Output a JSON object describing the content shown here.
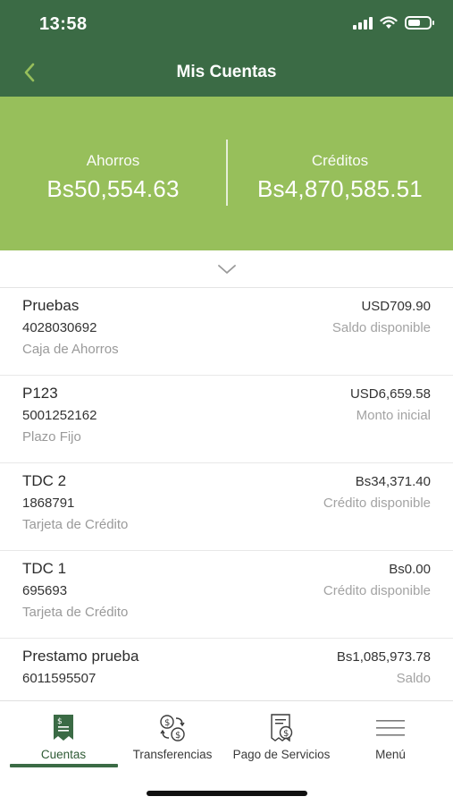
{
  "status": {
    "time": "13:58"
  },
  "nav": {
    "title": "Mis Cuentas"
  },
  "summary": {
    "savings": {
      "label": "Ahorros",
      "amount": "Bs50,554.63"
    },
    "credits": {
      "label": "Créditos",
      "amount": "Bs4,870,585.51"
    }
  },
  "accounts": [
    {
      "name": "Pruebas",
      "number": "4028030692",
      "type": "Caja de Ahorros",
      "amount": "USD709.90",
      "amount_label": "Saldo disponible"
    },
    {
      "name": "P123",
      "number": "5001252162",
      "type": "Plazo Fijo",
      "amount": "USD6,659.58",
      "amount_label": "Monto inicial"
    },
    {
      "name": "TDC 2",
      "number": "1868791",
      "type": "Tarjeta de Crédito",
      "amount": "Bs34,371.40",
      "amount_label": "Crédito disponible"
    },
    {
      "name": "TDC 1",
      "number": "695693",
      "type": "Tarjeta de Crédito",
      "amount": "Bs0.00",
      "amount_label": "Crédito disponible"
    },
    {
      "name": "Prestamo prueba",
      "number": "6011595507",
      "type": "",
      "amount": "Bs1,085,973.78",
      "amount_label": "Saldo"
    }
  ],
  "tabs": [
    {
      "label": "Cuentas",
      "icon": "accounts-icon",
      "active": true
    },
    {
      "label": "Transferencias",
      "icon": "transfer-icon",
      "active": false
    },
    {
      "label": "Pago de Servicios",
      "icon": "bill-payment-icon",
      "active": false
    },
    {
      "label": "Menú",
      "icon": "menu-icon",
      "active": false
    }
  ],
  "colors": {
    "header": "#3b6b45",
    "summary": "#97bf5b",
    "back_arrow": "#97bf5b",
    "active_tab": "#3b6b45"
  }
}
